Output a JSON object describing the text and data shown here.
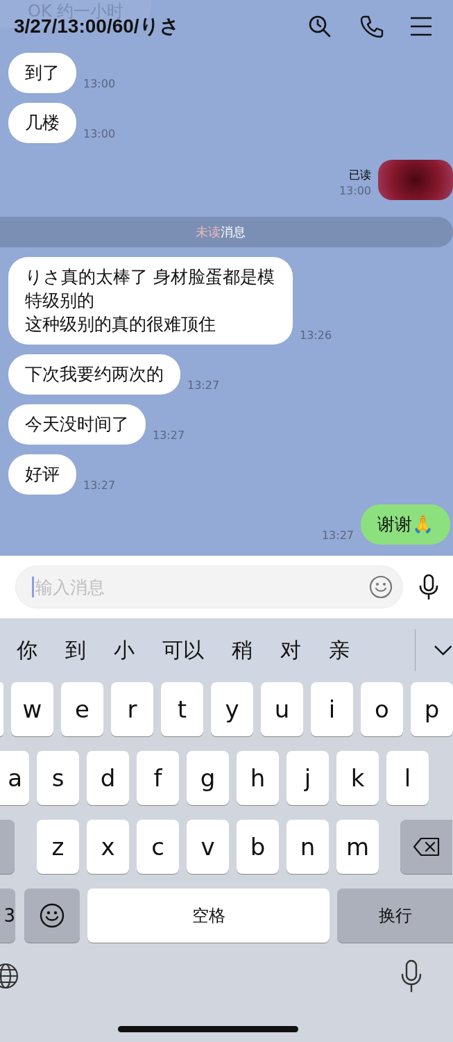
{
  "pinned_preview": "OK 约一小时",
  "header": {
    "title": "3/27/13:00/60/りさ"
  },
  "messages": [
    {
      "kind": "received",
      "text": "到了",
      "time": "13:00"
    },
    {
      "kind": "received",
      "text": "几楼",
      "time": "13:00"
    },
    {
      "kind": "sticker",
      "read": "已读",
      "time": "13:00"
    },
    {
      "kind": "divider",
      "highlight": "未读",
      "text": "消息"
    },
    {
      "kind": "received",
      "lines": [
        "りさ真的太棒了 身材脸蛋都是模特级别的",
        "这种级别的真的很难顶住"
      ],
      "time": "13:26"
    },
    {
      "kind": "received",
      "text": "下次我要约两次的",
      "time": "13:27"
    },
    {
      "kind": "received",
      "text": "今天没时间了",
      "time": "13:27"
    },
    {
      "kind": "received",
      "text": "好评",
      "time": "13:27"
    },
    {
      "kind": "sent",
      "text": "谢谢🙏",
      "time": "13:27"
    }
  ],
  "input": {
    "placeholder": "输入消息"
  },
  "suggestions": [
    "你",
    "到",
    "小",
    "可以",
    "稍",
    "对",
    "亲"
  ],
  "keyboard": {
    "rows": [
      [
        "",
        "w",
        "e",
        "r",
        "t",
        "y",
        "u",
        "i",
        "o",
        "p"
      ],
      [
        "a",
        "s",
        "d",
        "f",
        "g",
        "h",
        "j",
        "k",
        "l"
      ],
      [
        "",
        "z",
        "x",
        "c",
        "v",
        "b",
        "n",
        "m"
      ]
    ],
    "numbers_key": "3",
    "space": "空格",
    "return": "换行"
  }
}
